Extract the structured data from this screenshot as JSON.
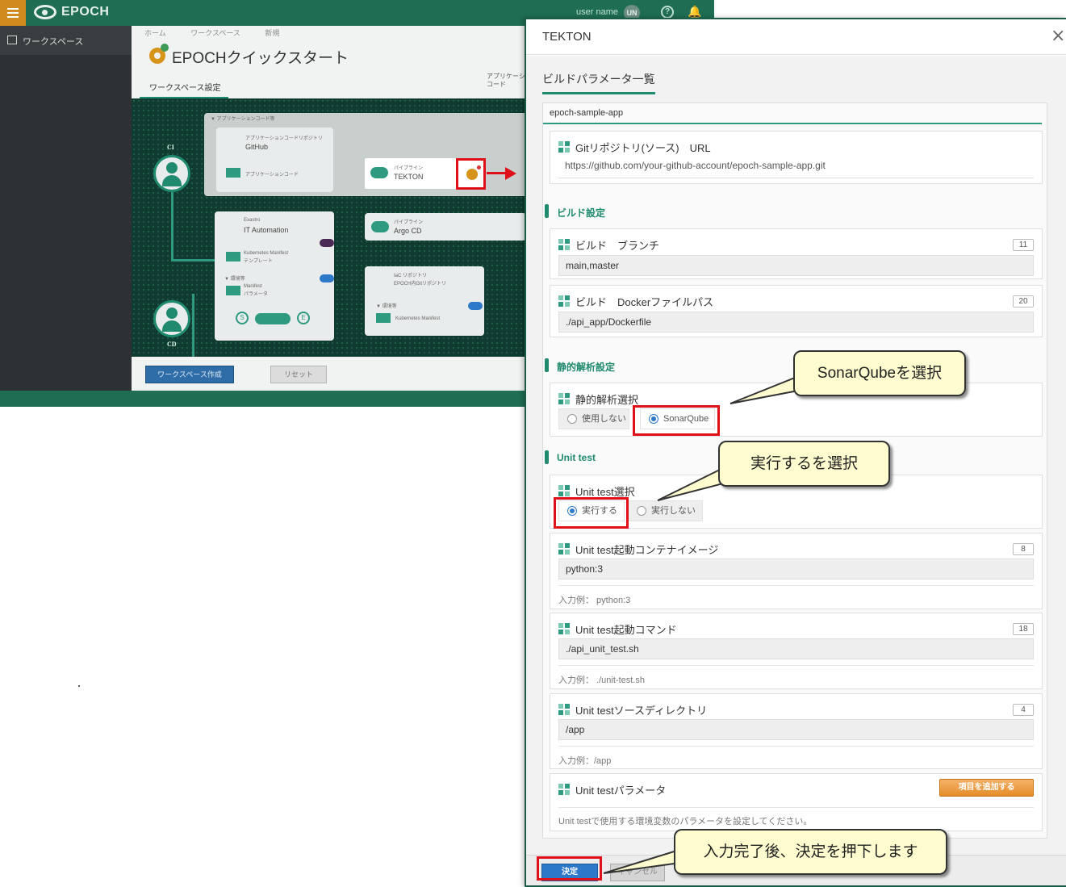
{
  "background_app": {
    "brand": "EPOCH",
    "user_name": "user name",
    "user_initials": "UN",
    "sidebar_item": "ワークスペース",
    "breadcrumb": [
      "ホーム",
      "ワークスペース",
      "新規"
    ],
    "page_title": "EPOCHクイックスタート",
    "tab_workspace": "ワークスペース設定",
    "tab_app_line1": "アプリケーシ",
    "tab_app_line2": "コード",
    "canvas": {
      "ci_label": "CI",
      "cd_label": "CD",
      "group_app_code": "▼ アプリケーションコード等",
      "repo_small": "アプリケーションコードリポジトリ",
      "repo_name": "GitHub",
      "app_code": "アプリケーションコード",
      "pipeline_small": "パイプライン",
      "tekton": "TEKTON",
      "argocd_small": "パイプライン",
      "argocd": "Argo CD",
      "exastro_small": "Exastro",
      "exastro": "IT Automation",
      "manifest_tpl_1": "Kubernetes Manifest",
      "manifest_tpl_2": "テンプレート",
      "env_small": "▼ 環境等",
      "manifest_param_1": "Manifest",
      "manifest_param_2": "パラメータ",
      "iac_small": "IaC リポジトリ",
      "iac": "EPOCH内Gitリポジトリ",
      "env_small_2": "▼ 環境等",
      "k8s_manifest": "Kubernetes Manifest",
      "s_label": "S",
      "e_label": "E"
    },
    "create_button": "ワークスペース作成",
    "reset_button": "リセット"
  },
  "modal": {
    "title": "TEKTON",
    "close": "×",
    "section_tab": "ビルドパラメータ一覧",
    "app_tab": "epoch-sample-app",
    "git_url": {
      "label": "Gitリポジトリ(ソース)　URL",
      "value": "https://github.com/your-github-account/epoch-sample-app.git"
    },
    "build_section": "ビルド設定",
    "build_branch": {
      "label": "ビルド　ブランチ",
      "count": "11",
      "value": "main,master"
    },
    "build_dockerfile": {
      "label": "ビルド　Dockerファイルパス",
      "count": "20",
      "value": "./api_app/Dockerfile"
    },
    "static_section": "静的解析設定",
    "static_select": {
      "label": "静的解析選択",
      "options": [
        "使用しない",
        "SonarQube"
      ],
      "selected": "SonarQube"
    },
    "unit_section": "Unit test",
    "unit_select": {
      "label": "Unit test選択",
      "options": [
        "実行する",
        "実行しない"
      ],
      "selected": "実行する"
    },
    "unit_image": {
      "label": "Unit test起動コンテナイメージ",
      "count": "8",
      "value": "python:3",
      "hint": "入力例： python:3"
    },
    "unit_command": {
      "label": "Unit test起動コマンド",
      "count": "18",
      "value": "./api_unit_test.sh",
      "hint": "入力例： ./unit-test.sh"
    },
    "unit_dir": {
      "label": "Unit testソースディレクトリ",
      "count": "4",
      "value": "/app",
      "hint": "入力例：/app"
    },
    "unit_params": {
      "label": "Unit testパラメータ",
      "add_button": "項目を追加する",
      "hint": "Unit testで使用する環境変数のパラメータを設定してください。"
    },
    "ok_button": "決定",
    "cancel_button": "キャンセル"
  },
  "callouts": {
    "sonarqube": "SonarQubeを選択",
    "unit_test": "実行するを選択",
    "submit": "入力完了後、決定を押下します"
  },
  "colors": {
    "epoch_green": "#1f6e54",
    "accent_teal": "#1f8a6d",
    "highlight_red": "#e0101a",
    "primary_blue": "#2d78c8",
    "callout_yellow": "#fffcd0"
  }
}
